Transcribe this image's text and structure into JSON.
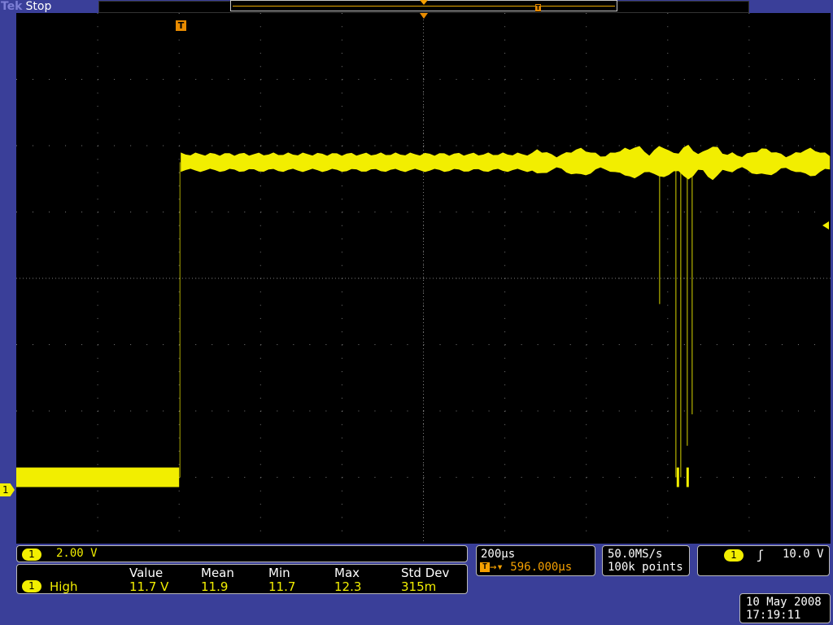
{
  "header": {
    "brand": "Tek",
    "run_state": "Stop"
  },
  "record_view": {
    "trigger_icon": "T",
    "center_marker": "center-triangle-icon"
  },
  "screen": {
    "trigger_marker": "T",
    "channel_marker": "1",
    "trigger_level_marker": "trigger-level-arrow-icon"
  },
  "chart_data": {
    "type": "line",
    "grid": {
      "divisions_x": 10,
      "divisions_y": 8
    },
    "title": "",
    "xlabel": "",
    "ylabel": "",
    "series": [
      {
        "low_level_divisions_above_bottom": 1.0,
        "high_level_divisions_above_bottom": 5.75,
        "step_division": 2.0,
        "dropout_division": 8.2
      }
    ]
  },
  "panels": {
    "scale": {
      "channel": "1",
      "value": "2.00 V"
    },
    "measurement": {
      "channel": "1",
      "name": "High",
      "headers": [
        "Value",
        "Mean",
        "Min",
        "Max",
        "Std Dev"
      ],
      "values": [
        "11.7 V",
        "11.9",
        "11.7",
        "12.3",
        "315m"
      ]
    },
    "timebase": {
      "scale": "200µs",
      "position_icon": "T",
      "arrow": "→▾",
      "position": "596.000µs"
    },
    "acquisition": {
      "rate": "50.0MS/s",
      "points": "100k points"
    },
    "trigger": {
      "channel": "1",
      "slope": "ʃ",
      "level": "10.0 V"
    },
    "date": {
      "date": "10 May 2008",
      "time": "17:19:11"
    }
  },
  "colors": {
    "trace": "#f2ee00",
    "trigger": "#e88b00",
    "frame": "#3a3f99",
    "screen": "#000000"
  }
}
